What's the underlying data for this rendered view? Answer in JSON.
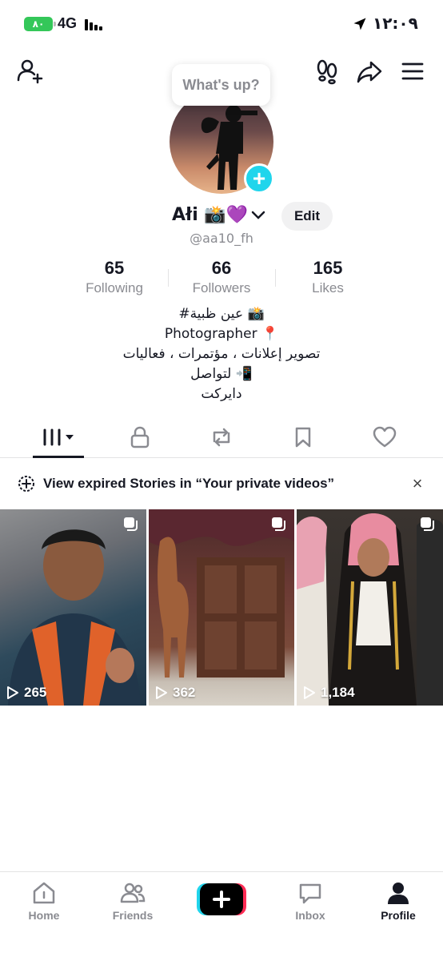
{
  "status_bar": {
    "battery": "٨٠",
    "network": "4G",
    "time": "١٢:٠٩"
  },
  "header": {
    "bubble_text": "What's up?"
  },
  "profile": {
    "display_name": "Ałi 📸💜",
    "username": "@aa10_fh",
    "edit_label": "Edit",
    "stats": [
      {
        "value": "65",
        "label": "Following"
      },
      {
        "value": "66",
        "label": "Followers"
      },
      {
        "value": "165",
        "label": "Likes"
      }
    ],
    "bio_lines": [
      "#عين ظبية 📸",
      "Photographer 📍",
      "تصوير إعلانات ، مؤتمرات ، فعاليات",
      "لتواصل 📲",
      "دايركت"
    ]
  },
  "banner": {
    "text": "View expired Stories in “Your private videos”"
  },
  "videos": [
    {
      "views": "265"
    },
    {
      "views": "362"
    },
    {
      "views": "1,184"
    }
  ],
  "bottom_nav": {
    "home": "Home",
    "friends": "Friends",
    "inbox": "Inbox",
    "profile": "Profile"
  },
  "colors": {
    "accent_cyan": "#20d5ec",
    "accent_pink": "#fe2c55",
    "text_primary": "#161823",
    "text_secondary": "#8a8b91"
  }
}
